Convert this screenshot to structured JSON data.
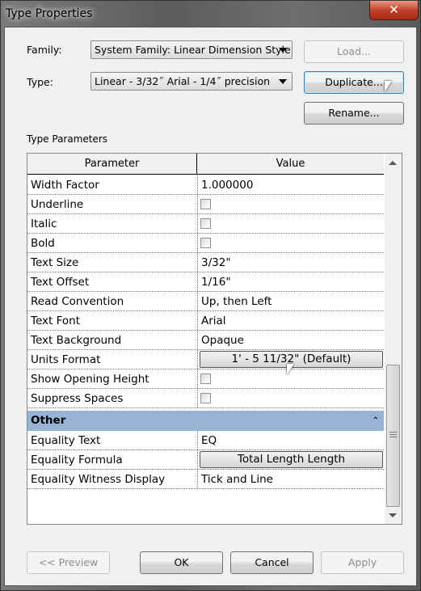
{
  "window": {
    "title": "Type Properties",
    "close_icon": "close-x-icon"
  },
  "family": {
    "label": "Family:",
    "value": "System Family: Linear Dimension Style"
  },
  "type": {
    "label": "Type:",
    "value": "Linear - 3/32˝ Arial - 1/4˝ precision"
  },
  "buttons": {
    "load": "Load...",
    "duplicate": "Duplicate...",
    "rename": "Rename...",
    "preview": "<< Preview",
    "ok": "OK",
    "cancel": "Cancel",
    "apply": "Apply"
  },
  "section_label": "Type Parameters",
  "table": {
    "headers": [
      "Parameter",
      "Value"
    ],
    "rows": [
      {
        "param": "Width Factor",
        "kind": "text",
        "value": "1.000000"
      },
      {
        "param": "Underline",
        "kind": "checkbox",
        "checked": false
      },
      {
        "param": "Italic",
        "kind": "checkbox",
        "checked": false
      },
      {
        "param": "Bold",
        "kind": "checkbox",
        "checked": false
      },
      {
        "param": "Text Size",
        "kind": "text",
        "value": "3/32\""
      },
      {
        "param": "Text Offset",
        "kind": "text",
        "value": "1/16\""
      },
      {
        "param": "Read Convention",
        "kind": "text",
        "value": "Up, then Left"
      },
      {
        "param": "Text Font",
        "kind": "text",
        "value": "Arial"
      },
      {
        "param": "Text Background",
        "kind": "text",
        "value": "Opaque"
      },
      {
        "param": "Units Format",
        "kind": "button",
        "value": "1' - 5 11/32\" (Default)"
      },
      {
        "param": "Show Opening Height",
        "kind": "checkbox",
        "checked": false
      },
      {
        "param": "Suppress Spaces",
        "kind": "checkbox",
        "checked": false
      }
    ],
    "group": {
      "label": "Other",
      "collapse_icon": "double-chevron-up-icon"
    },
    "group_rows": [
      {
        "param": "Equality Text",
        "kind": "text",
        "value": "EQ"
      },
      {
        "param": "Equality Formula",
        "kind": "button",
        "value": "Total Length Length"
      },
      {
        "param": "Equality Witness Display",
        "kind": "text",
        "value": "Tick and Line"
      }
    ]
  },
  "colors": {
    "group_header": "#98b4d4",
    "close_button": "#c0412a"
  }
}
